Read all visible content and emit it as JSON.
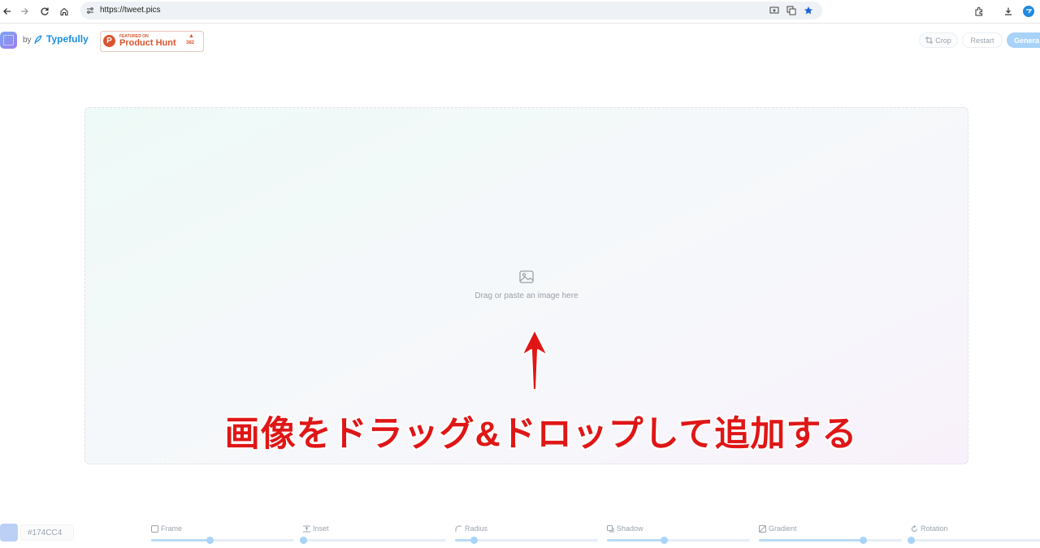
{
  "browser": {
    "url": "https://tweet.pics"
  },
  "header": {
    "by_label": "by",
    "brand": "Typefully",
    "producthunt": {
      "featured_label": "FEATURED ON",
      "name": "Product Hunt",
      "upvotes": "382"
    },
    "crop_label": "Crop",
    "restart_label": "Restart",
    "generate_label": "Genera"
  },
  "dropzone": {
    "hint": "Drag or paste an image here"
  },
  "annotation": {
    "text": "画像をドラッグ&ドロップして追加する",
    "color": "#e01616"
  },
  "controls": {
    "color_hex": "#174CC4",
    "sliders": [
      {
        "label": "Frame",
        "icon": "frame-icon",
        "value": 0.41
      },
      {
        "label": "Inset",
        "icon": "inset-icon",
        "value": 0.0
      },
      {
        "label": "Radius",
        "icon": "radius-icon",
        "value": 0.13
      },
      {
        "label": "Shadow",
        "icon": "shadow-icon",
        "value": 0.4
      },
      {
        "label": "Gradient",
        "icon": "gradient-icon",
        "value": 0.73
      },
      {
        "label": "Rotation",
        "icon": "rotation-icon",
        "value": 0.0
      }
    ]
  },
  "colors": {
    "accent": "#1a8fe0",
    "producthunt": "#da552f",
    "generate_bg": "#a8d2f7"
  }
}
